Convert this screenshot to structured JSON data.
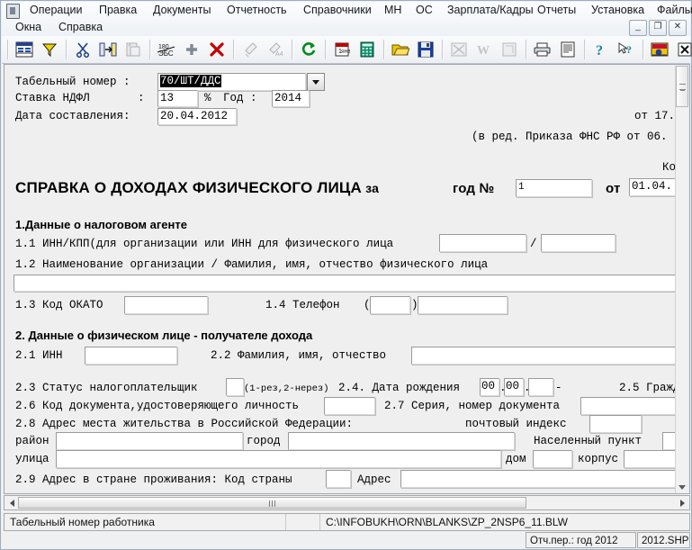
{
  "window": {
    "menu_row1": [
      {
        "label": "Операции"
      },
      {
        "label": "Правка"
      },
      {
        "label": "Документы"
      },
      {
        "label": "Отчетность"
      },
      {
        "label": "Справочники"
      },
      {
        "label": "МН"
      },
      {
        "label": "ОС"
      },
      {
        "label": "Зарплата/Кадры"
      },
      {
        "label": "Отчеты"
      },
      {
        "label": "Установка"
      },
      {
        "label": "Файлы"
      }
    ],
    "menu_row2": [
      {
        "label": "Окна"
      },
      {
        "label": "Справка"
      }
    ],
    "minimize": "_",
    "restore": "❐",
    "close": "✕"
  },
  "toolbar": {
    "items": [
      {
        "name": "table-view-icon",
        "enabled": true
      },
      {
        "name": "filter-icon",
        "enabled": true
      },
      {
        "name": "cut-icon",
        "enabled": true
      },
      {
        "name": "page-insert-icon",
        "enabled": true
      },
      {
        "name": "paste-icon",
        "enabled": false
      },
      {
        "name": "rotate-180-icon",
        "enabled": true
      },
      {
        "name": "add-plus-icon",
        "enabled": true
      },
      {
        "name": "delete-cross-icon",
        "enabled": true
      },
      {
        "name": "brush-icon",
        "enabled": false
      },
      {
        "name": "format-brush-icon",
        "enabled": false
      },
      {
        "name": "refresh-icon",
        "enabled": true
      },
      {
        "name": "calendar-icon",
        "enabled": true
      },
      {
        "name": "calculator-icon",
        "enabled": true
      },
      {
        "name": "open-folder-icon",
        "enabled": true
      },
      {
        "name": "save-disk-icon",
        "enabled": true
      },
      {
        "name": "excel-export-icon",
        "enabled": false
      },
      {
        "name": "word-export-icon",
        "enabled": false
      },
      {
        "name": "archive-icon",
        "enabled": false
      },
      {
        "name": "print-icon",
        "enabled": true
      },
      {
        "name": "print-preview-icon",
        "enabled": true
      },
      {
        "name": "help-icon",
        "enabled": true
      },
      {
        "name": "context-help-icon",
        "enabled": true
      },
      {
        "name": "blank-editor-icon",
        "enabled": true
      },
      {
        "name": "close-window-icon",
        "enabled": true
      },
      {
        "name": "exit-icon",
        "enabled": true
      }
    ]
  },
  "form": {
    "header": {
      "tab_number_label": "Табельный номер :",
      "tab_number_value": "70/ШТ/ДДС",
      "ndfl_rate_label": "Ставка НДФЛ",
      "ndfl_rate_colon": ":",
      "ndfl_rate_value": "13",
      "percent_sign": "%",
      "year_label": "Год :",
      "year_value": "2014",
      "compose_date_label": "Дата составления:",
      "compose_date_value": "20.04.2012",
      "ot_note": "от 17.",
      "red_note": "(в ред. Приказа ФНС РФ от 06.",
      "code_note": "Ко"
    },
    "title": {
      "main": "СПРАВКА О ДОХОДАХ ФИЗИЧЕСКОГО ЛИЦА",
      "za": "за",
      "year_no_label": "год №",
      "year_no_value": "1",
      "ot_label": "от",
      "ot_value": "01.04."
    },
    "section1": {
      "heading": "1.Данные о налоговом агенте",
      "row11_label": "1.1 ИНН/КПП(для организации или ИНН для физического лица",
      "row11_inn": "",
      "row11_sep": "/",
      "row11_kpp": "",
      "row12_label": "1.2 Наименование организации / Фамилия, имя, отчество физического лица",
      "row12_value": "",
      "row13_label": "1.3 Код ОКАТО",
      "row13_value": "",
      "row14_label": "1.4 Телефон",
      "row14_paren_open": "(",
      "row14_code": "",
      "row14_paren_close": ")",
      "row14_number": ""
    },
    "section2": {
      "heading": "2. Данные о физическом лице - получателе дохода",
      "row21_label": "2.1 ИНН",
      "row21_value": "",
      "row22_label": "2.2 Фамилия, имя, отчество",
      "row22_value": "",
      "row23_label": "2.3 Статус налогоплательщик",
      "row23_value": "",
      "row23_hint": "(1-рез,2-нерез)",
      "row24_label": "2.4. Дата рождения",
      "row24_day": "00",
      "row24_dot1": ".",
      "row24_month": "00",
      "row24_dot2": ".",
      "row24_year": "",
      "row24_dash": "-",
      "row25_label": "2.5 Гражд",
      "row26_label": "2.6 Код документа,удостоверяющего личность",
      "row26_value": "",
      "row27_label": "2.7 Серия, номер документа",
      "row27_value": "",
      "row28_label": "2.8 Адрес места жительства в Российской Федерации:",
      "postal_label": "почтовый индекс",
      "postal_value": "",
      "district_label": "район",
      "district_value": "",
      "city_label": "город",
      "city_value": "",
      "locality_label": "Населенный пункт",
      "locality_value": "",
      "street_label": "улица",
      "street_value": "",
      "house_label": "дом",
      "house_value": "",
      "building_label": "корпус",
      "building_value": "",
      "row29_label": "2.9 Адрес в стране проживания: Код страны",
      "row29_country": "",
      "row29_address_label": "Адрес",
      "row29_address_value": ""
    }
  },
  "status": {
    "field_hint": "Табельный номер работника",
    "file_path": "C:\\INFOBUKH\\ORN\\BLANKS\\ZP_2NSP6_11.BLW",
    "period": "Отч.пер.: год 2012",
    "shape_file": "2012.SHP"
  }
}
